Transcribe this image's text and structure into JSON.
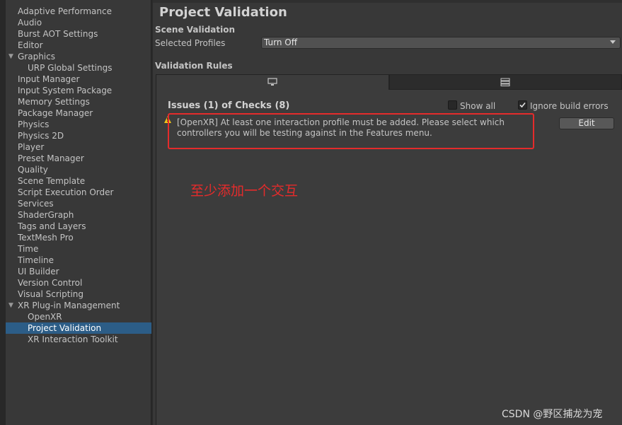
{
  "sidebar": {
    "items": [
      {
        "label": "Adaptive Performance"
      },
      {
        "label": "Audio"
      },
      {
        "label": "Burst AOT Settings"
      },
      {
        "label": "Editor"
      },
      {
        "label": "Graphics"
      },
      {
        "label": "URP Global Settings"
      },
      {
        "label": "Input Manager"
      },
      {
        "label": "Input System Package"
      },
      {
        "label": "Memory Settings"
      },
      {
        "label": "Package Manager"
      },
      {
        "label": "Physics"
      },
      {
        "label": "Physics 2D"
      },
      {
        "label": "Player"
      },
      {
        "label": "Preset Manager"
      },
      {
        "label": "Quality"
      },
      {
        "label": "Scene Template"
      },
      {
        "label": "Script Execution Order"
      },
      {
        "label": "Services"
      },
      {
        "label": "ShaderGraph"
      },
      {
        "label": "Tags and Layers"
      },
      {
        "label": "TextMesh Pro"
      },
      {
        "label": "Time"
      },
      {
        "label": "Timeline"
      },
      {
        "label": "UI Builder"
      },
      {
        "label": "Version Control"
      },
      {
        "label": "Visual Scripting"
      },
      {
        "label": "XR Plug-in Management"
      },
      {
        "label": "OpenXR"
      },
      {
        "label": "Project Validation"
      },
      {
        "label": "XR Interaction Toolkit"
      }
    ],
    "selected": "Project Validation",
    "expanded": [
      "Graphics",
      "XR Plug-in Management"
    ]
  },
  "main": {
    "title": "Project Validation",
    "scene_validation_label": "Scene Validation",
    "selected_profiles_label": "Selected Profiles",
    "selected_profiles_value": "Turn Off",
    "validation_rules_label": "Validation Rules",
    "tabs": [
      {
        "icon": "monitor-icon",
        "active": true
      },
      {
        "icon": "server-icon",
        "active": false
      }
    ],
    "issues_title": "Issues (1) of Checks (8)",
    "show_all_label": "Show all",
    "show_all_checked": false,
    "ignore_build_errors_label": "Ignore build errors",
    "ignore_build_errors_checked": true,
    "issue": {
      "icon": "warning-icon",
      "text": "[OpenXR] At least one interaction profile must be added.  Please select which controllers you will be testing against in the Features menu.",
      "button_label": "Edit"
    }
  },
  "annotation": {
    "text": "至少添加一个交互",
    "color": "#e52b2b"
  },
  "watermark": "CSDN @野区捕龙为宠",
  "colors": {
    "background": "#383838",
    "selected_row": "#2c5d87",
    "annotation_red": "#e52b2b",
    "warning_yellow": "#f0c419"
  }
}
